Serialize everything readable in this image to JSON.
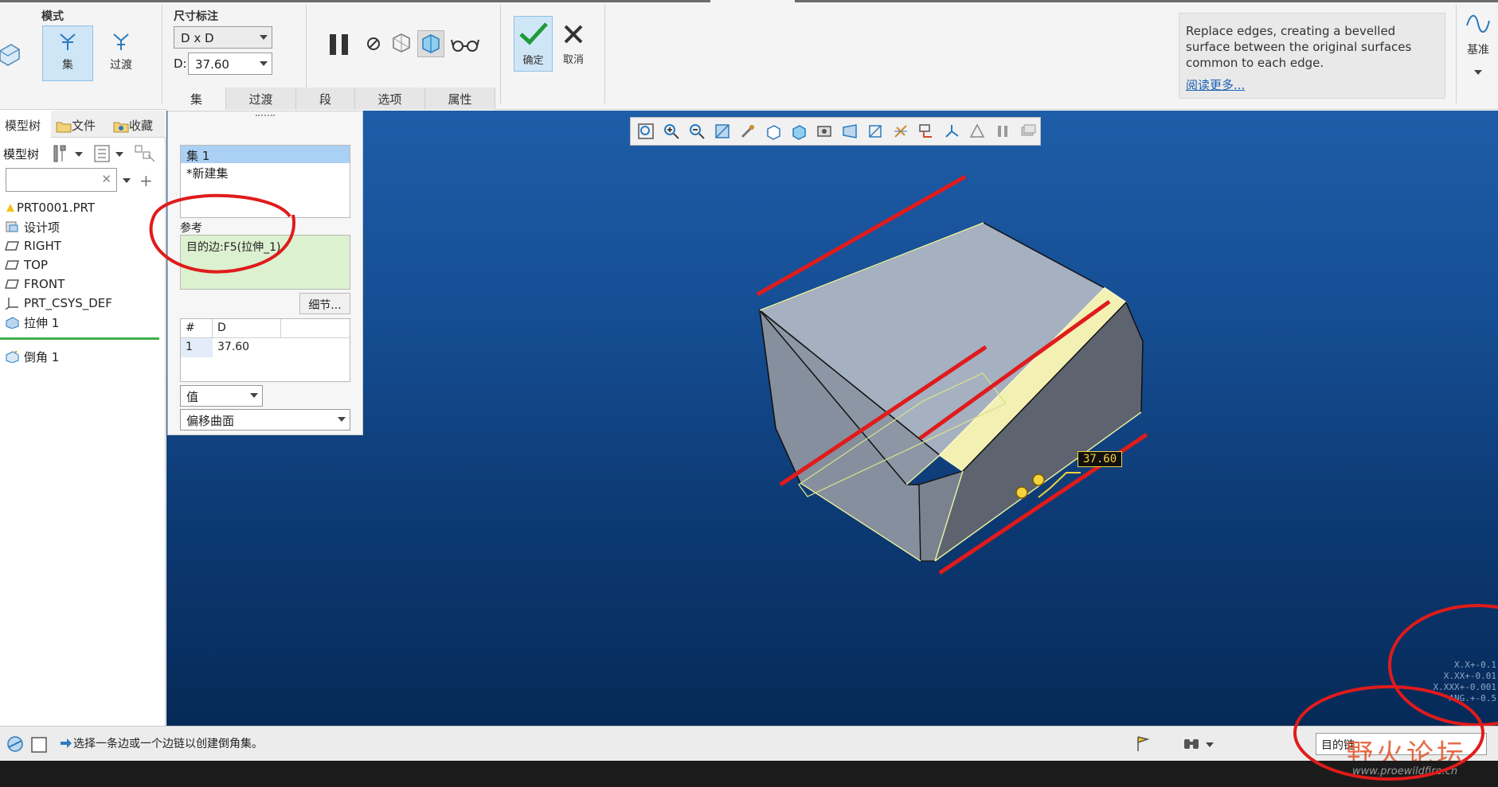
{
  "ribbon": {
    "mode_group_label": "模式",
    "mode_buttons": [
      {
        "label": "集",
        "active": true
      },
      {
        "label": "过渡",
        "active": false
      }
    ],
    "dim_group_label": "尺寸标注",
    "dim_scheme_value": "D x D",
    "d_label": "D:",
    "d_value": "37.60",
    "ok_label": "确定",
    "cancel_label": "取消",
    "tabs": [
      {
        "label": "集",
        "active": true
      },
      {
        "label": "过渡",
        "active": false
      },
      {
        "label": "段",
        "active": false
      },
      {
        "label": "选项",
        "active": false
      },
      {
        "label": "属性",
        "active": false
      }
    ],
    "help_text": "Replace edges, creating a bevelled surface between the original surfaces common to each edge.",
    "help_link": "阅读更多...",
    "datum_label": "基准"
  },
  "left_panel": {
    "tabs": [
      "模型树",
      "文件",
      "收藏"
    ],
    "tree_label": "模型树",
    "search_value": "",
    "tree_items": [
      {
        "label": "PRT0001.PRT",
        "icon": "part-icon"
      },
      {
        "label": "设计项",
        "icon": "design-items-icon"
      },
      {
        "label": "RIGHT",
        "icon": "datum-plane-icon"
      },
      {
        "label": "TOP",
        "icon": "datum-plane-icon"
      },
      {
        "label": "FRONT",
        "icon": "datum-plane-icon"
      },
      {
        "label": "PRT_CSYS_DEF",
        "icon": "csys-icon"
      },
      {
        "label": "拉伸 1",
        "icon": "extrude-icon"
      },
      {
        "label": "倒角 1",
        "icon": "chamfer-icon"
      }
    ]
  },
  "set_panel": {
    "sets": [
      "集 1",
      "*新建集"
    ],
    "reference_label": "参考",
    "reference_value": "目的边:F5(拉伸_1)",
    "detail_button": "细节...",
    "table": {
      "headers": [
        "#",
        "D"
      ],
      "rows": [
        [
          "1",
          "37.60"
        ]
      ]
    },
    "value_mode": "值",
    "offset_mode": "偏移曲面"
  },
  "viewport": {
    "dimension_label": "37.60",
    "tolerances": [
      "X.X+-0.1",
      "X.XX+-0.01",
      "X.XXX+-0.001",
      "ANG.+-0.5"
    ],
    "watermark_title": "野火论坛",
    "watermark_url": "www.proewildfire.cn",
    "colors": {
      "background": "#0d3a74",
      "highlight": "#f3f0b4",
      "annotation": "#e01b1b"
    }
  },
  "status": {
    "message": "选择一条边或一个边链以创建倒角集。",
    "filter_value": "目的链"
  }
}
